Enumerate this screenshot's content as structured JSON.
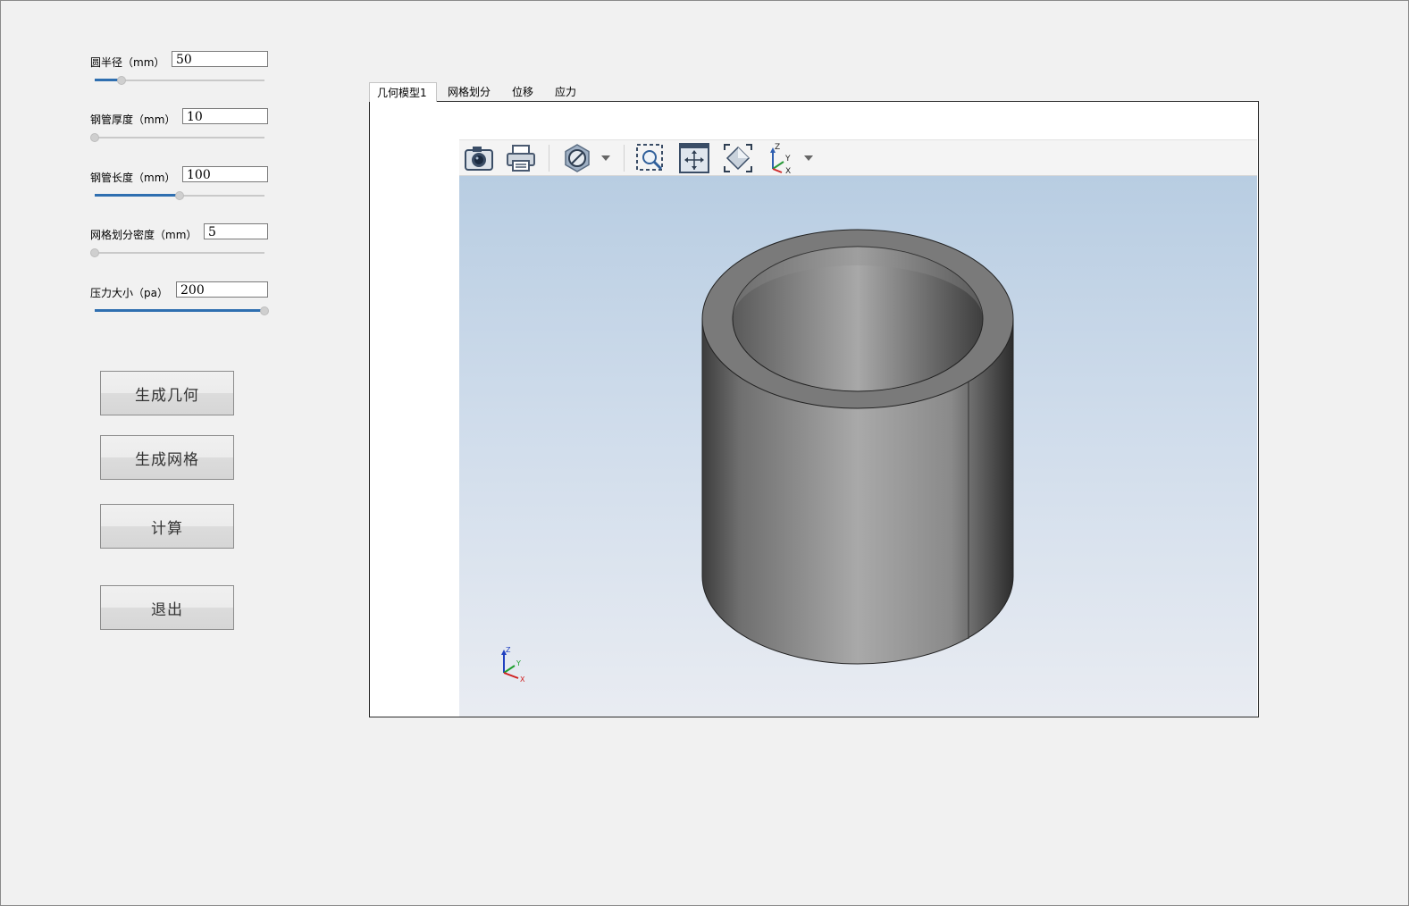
{
  "params": [
    {
      "label": "圆半径（mm）",
      "value": "50",
      "slider_fraction": 0.16
    },
    {
      "label": "钢管厚度（mm）",
      "value": "10",
      "slider_fraction": 0.0
    },
    {
      "label": "钢管长度（mm）",
      "value": "100",
      "slider_fraction": 0.5
    },
    {
      "label": "网格划分密度（mm）",
      "value": "5",
      "slider_fraction": 0.0
    },
    {
      "label": "压力大小（pa）",
      "value": "200",
      "slider_fraction": 1.0
    }
  ],
  "buttons": {
    "generate_geometry": "生成几何",
    "generate_mesh": "生成网格",
    "compute": "计算",
    "exit": "退出"
  },
  "tabs": [
    "几何模型1",
    "网格划分",
    "位移",
    "应力"
  ],
  "active_tab": 0,
  "toolbar": {
    "icons": [
      "camera-icon",
      "print-icon",
      "cut-plane-icon",
      "zoom-window-icon",
      "pan-icon",
      "fit-all-icon",
      "axis-view-icon"
    ]
  },
  "axis_labels": {
    "z": "Z",
    "y": "Y",
    "x": "X"
  },
  "colors": {
    "slider_fill": "#2f6fb0",
    "viewport_top": "#b8cde2",
    "viewport_bottom": "#e9ecf2"
  }
}
